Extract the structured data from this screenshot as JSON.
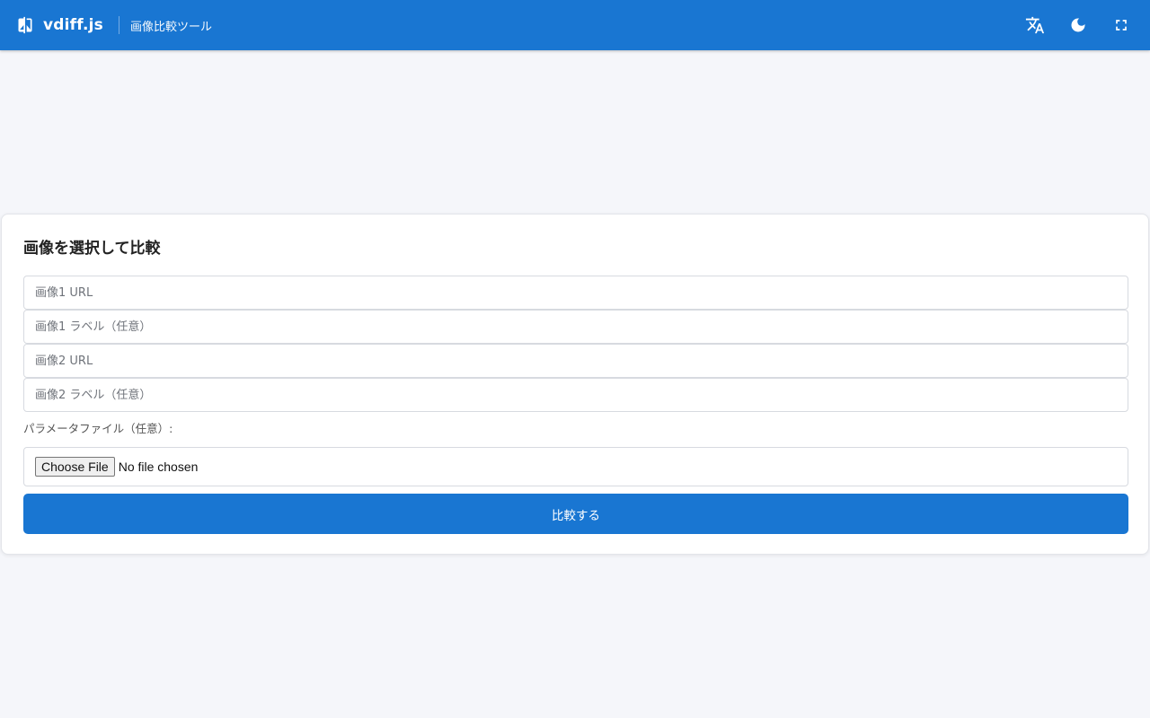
{
  "header": {
    "brand_name": "vdiff.js",
    "subtitle": "画像比較ツール",
    "actions": [
      {
        "icon": "translate-icon"
      },
      {
        "icon": "moon-icon"
      },
      {
        "icon": "fullscreen-icon"
      }
    ]
  },
  "form": {
    "title": "画像を選択して比較",
    "image1_url": {
      "placeholder": "画像1 URL",
      "value": ""
    },
    "image1_label": {
      "placeholder": "画像1 ラベル（任意）",
      "value": ""
    },
    "image2_url": {
      "placeholder": "画像2 URL",
      "value": ""
    },
    "image2_label": {
      "placeholder": "画像2 ラベル（任意）",
      "value": ""
    },
    "params_label": "パラメータファイル（任意）:",
    "file_button": "Choose File",
    "file_status": "No file chosen",
    "submit_label": "比較する"
  },
  "colors": {
    "primary": "#1976d2",
    "background": "#f5f6fa",
    "card": "#ffffff"
  }
}
